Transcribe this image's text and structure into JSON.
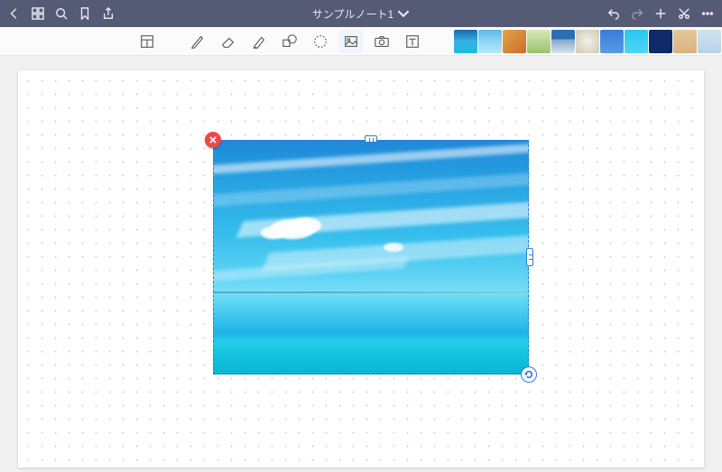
{
  "titlebar": {
    "title": "サンプルノート1",
    "icons": {
      "back": "back-icon",
      "thumbnails": "thumbnails-icon",
      "search": "search-icon",
      "bookmark": "bookmark-icon",
      "share": "share-icon",
      "undo": "undo-icon",
      "redo": "redo-icon",
      "add": "plus-icon",
      "scissors": "scissors-icon",
      "more": "more-icon"
    }
  },
  "toolbar": {
    "tools": [
      {
        "name": "page-layout-icon"
      },
      {
        "name": "pen-icon"
      },
      {
        "name": "eraser-icon"
      },
      {
        "name": "highlighter-icon"
      },
      {
        "name": "shapes-icon"
      },
      {
        "name": "lasso-icon"
      },
      {
        "name": "image-icon"
      },
      {
        "name": "camera-icon"
      },
      {
        "name": "text-icon"
      }
    ],
    "thumbs_count": 11
  },
  "selection": {
    "controls": {
      "delete": "close-icon",
      "rotate": "rotate-icon",
      "resize_top": "resize-handle-top",
      "resize_right": "resize-handle-right"
    },
    "image_description": "blue sky with white wispy clouds over turquoise ocean",
    "accent_color": "#2f7bd9",
    "delete_color": "#e94b4b"
  }
}
